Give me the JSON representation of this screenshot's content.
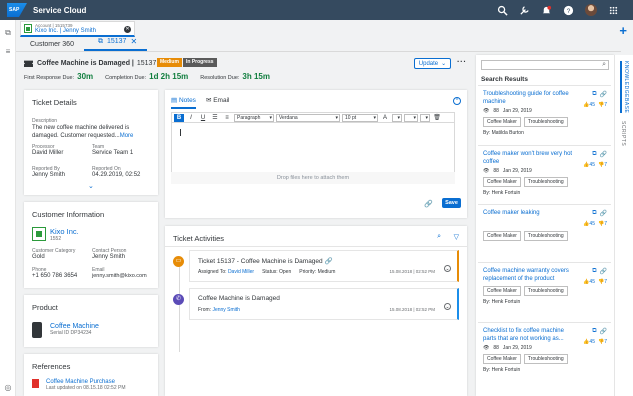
{
  "app": {
    "logo": "SAP",
    "title": "Service Cloud"
  },
  "account_tab": {
    "type": "Account | 1515739",
    "name": "Kixo Inc. | Jenny Smith"
  },
  "tabs": [
    {
      "label": "Customer 360"
    },
    {
      "label": "15137"
    }
  ],
  "header": {
    "title": "Coffee Machine is Damaged |",
    "id": "15137",
    "priority": "Medium",
    "status": "In Progress",
    "update_label": "Update",
    "dues": [
      {
        "label": "First Response Due:",
        "value": "30m"
      },
      {
        "label": "Completion Due:",
        "value": "1d 2h 15m"
      },
      {
        "label": "Resolution Due:",
        "value": "3h 15m"
      }
    ]
  },
  "ticket_details": {
    "title": "Ticket Details",
    "description_label": "Description",
    "description": "The new coffee machine delivered is damaged. Customer requested...",
    "more": "More",
    "processor_label": "Processor",
    "processor": "David Miller",
    "team_label": "Team",
    "team": "Service Team 1",
    "reported_by_label": "Reported By",
    "reported_by": "Jenny Smith",
    "reported_on_label": "Reported On",
    "reported_on": "04.29.2019, 02:52"
  },
  "customer_info": {
    "title": "Customer Information",
    "name": "Kixo Inc.",
    "id": "1552",
    "category_label": "Customer Category",
    "category": "Gold",
    "contact_label": "Contact Person",
    "contact": "Jenny Smith",
    "phone_label": "Phone",
    "phone": "+1 650 786 3654",
    "email_label": "Email",
    "email": "jenny.smith@kixo.com"
  },
  "product": {
    "title": "Product",
    "name": "Coffee Machine",
    "serial": "Serial ID DP34234"
  },
  "references": {
    "title": "References",
    "name": "Coffee Machine Purchase",
    "updated": "Last updated on 08.15.18 02:52 PM"
  },
  "editor": {
    "tab_notes": "Notes",
    "tab_email": "Email",
    "paragraph": "Paragraph",
    "font": "Verdana",
    "size": "10 pt",
    "drop_text": "Drop files here to attach them",
    "save_label": "Save"
  },
  "activities": {
    "title": "Ticket Activities",
    "items": [
      {
        "title": "Ticket 15137 - Coffee Machine is Damaged",
        "assigned_label": "Assigned To:",
        "assigned": "David Miller",
        "status": "Status: Open",
        "priority": "Priority: Medium",
        "date": "15.08.2018  |  02:52 PM",
        "accent": "#e78c07"
      },
      {
        "title": "Coffee Machine is Damaged",
        "from_label": "From:",
        "from": "Jenny Smith",
        "date": "15.08.2018  |  02:52 PM",
        "accent": "#1b8eea"
      }
    ]
  },
  "search": {
    "title": "Search Results",
    "results": [
      {
        "title": "Troubleshooting guide for coffee machine",
        "views": "88",
        "date": "Jan 29, 2019",
        "tags": [
          "Coffee Maker",
          "Troubleshooting"
        ],
        "author": "By: Matilda Burton",
        "up": "45",
        "down": "7"
      },
      {
        "title": "Coffee maker won't brew very hot coffee",
        "views": "88",
        "date": "Jan 29, 2019",
        "tags": [
          "Coffee Maker",
          "Troubleshooting"
        ],
        "author": "By: Henk Fortuin",
        "up": "45",
        "down": "7"
      },
      {
        "title": "Coffee maker leaking",
        "views": "",
        "date": "",
        "tags": [
          "Coffee Maker",
          "Troubleshooting"
        ],
        "author": "",
        "up": "45",
        "down": "7"
      },
      {
        "title": "Coffee machine warranty covers replacement of the product",
        "views": "",
        "date": "",
        "tags": [
          "Coffee Maker",
          "Troubleshooting"
        ],
        "author": "By: Henk Fortuin",
        "up": "45",
        "down": "7"
      },
      {
        "title": "Checklist to fix coffee machine parts that are not working as...",
        "views": "88",
        "date": "Jan 29, 2019",
        "tags": [
          "Coffee Maker",
          "Troubleshooting"
        ],
        "author": "By: Henk Fortuin",
        "up": "45",
        "down": "7"
      }
    ]
  },
  "side_tabs": {
    "knowledge": "KNOWLEDGEBASE",
    "scripts": "SCRIPTS"
  }
}
